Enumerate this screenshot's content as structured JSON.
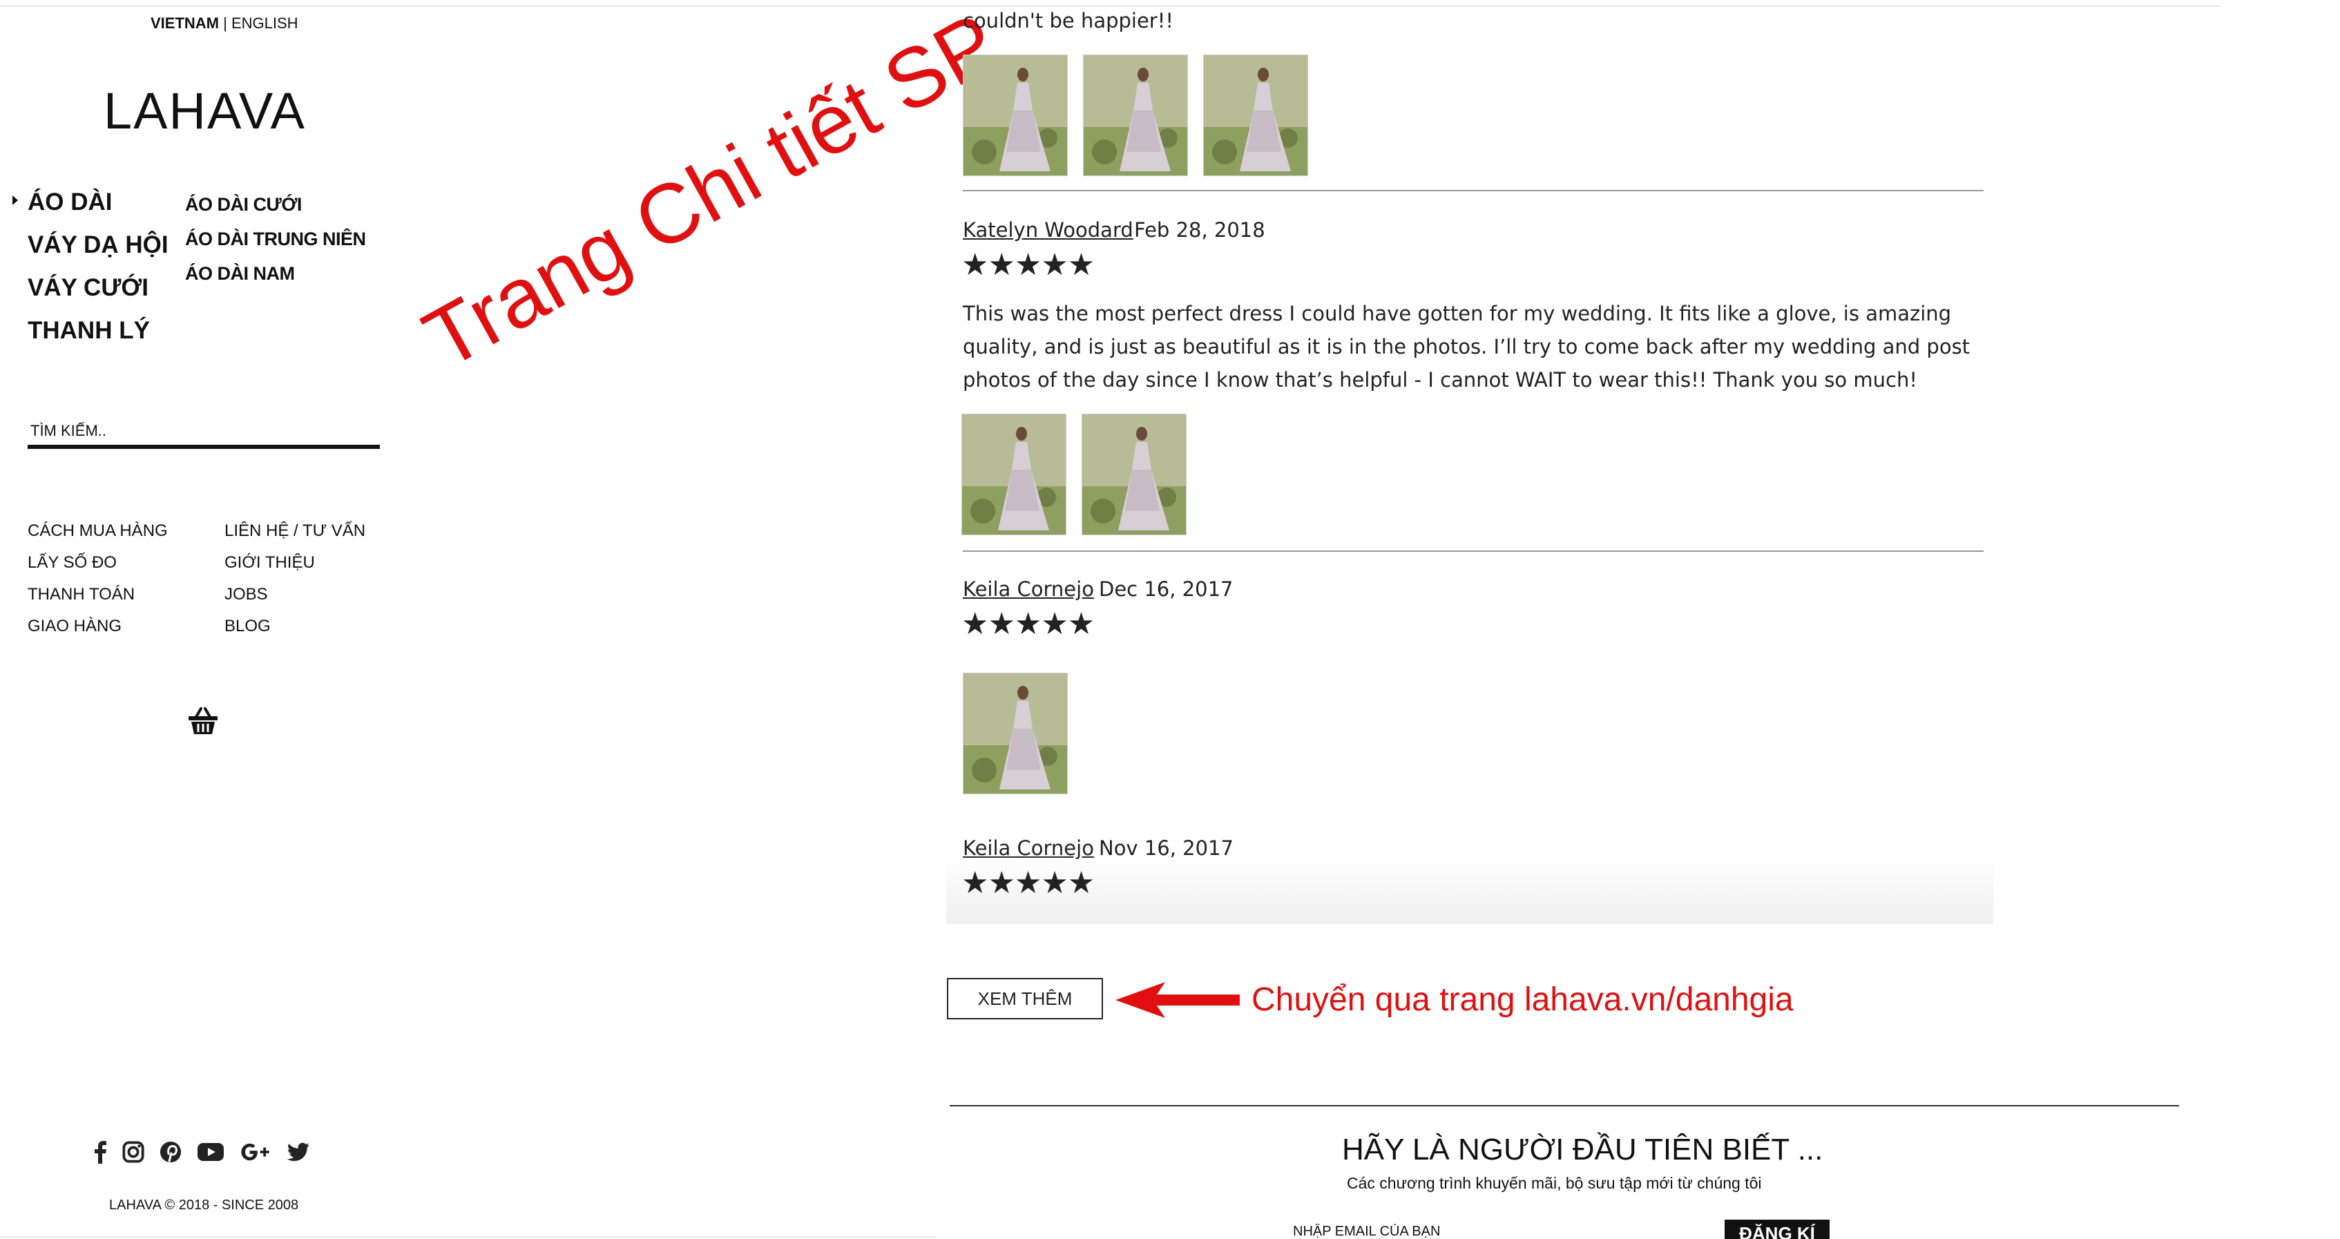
{
  "language": {
    "active": "VIETNAM",
    "separator": "|",
    "other": "ENGLISH"
  },
  "brand": {
    "logo": "LAHAVA"
  },
  "menu": {
    "main": [
      "ÁO DÀI",
      "VÁY DẠ HỘI",
      "VÁY CƯỚI",
      "THANH LÝ"
    ],
    "sub": [
      "ÁO DÀI CƯỚI",
      "ÁO DÀI TRUNG NIÊN",
      "ÁO DÀI NAM"
    ]
  },
  "search": {
    "placeholder": "TÌM KIẾM.."
  },
  "links": {
    "col1": [
      "CÁCH MUA HÀNG",
      "LẤY SỐ ĐO",
      "THANH TOÁN",
      "GIAO HÀNG"
    ],
    "col2": [
      "LIÊN HỆ / TƯ VẤN",
      "GIỚI THIỆU",
      "JOBS",
      "BLOG"
    ]
  },
  "icons": {
    "cart": "basket-icon",
    "social": [
      "facebook-icon",
      "instagram-icon",
      "pinterest-icon",
      "youtube-icon",
      "google-plus-icon",
      "twitter-icon"
    ]
  },
  "footer": {
    "copyright": "LAHAVA © 2018 - SINCE 2008"
  },
  "annotations": {
    "page_label": "Trang Chi tiết SP",
    "arrow_note": "Chuyển qua trang lahava.vn/danhgia"
  },
  "reviews": [
    {
      "author": "",
      "date": "",
      "stars": "",
      "text": "couldn't be happier!!",
      "photos": 3
    },
    {
      "author": "Katelyn Woodard",
      "date": "Feb 28, 2018",
      "stars": "★★★★★",
      "text": "This was the most perfect dress I could have gotten for my wedding. It fits like a glove, is amazing quality, and is just as beautiful as it is in the photos. I’ll try to come back after my wedding and post photos of the day since I know that’s helpful - I cannot WAIT to wear this!! Thank you so much!",
      "photos": 2
    },
    {
      "author": "Keila Cornejo",
      "date": "Dec 16, 2017",
      "stars": "★★★★★",
      "text": "",
      "photos": 1
    },
    {
      "author": "Keila Cornejo",
      "date": "Nov 16, 2017",
      "stars": "★★★★★",
      "text": "",
      "photos": 0
    }
  ],
  "more_button": {
    "label": "XEM THÊM"
  },
  "newsletter": {
    "title": "HÃY LÀ NGƯỜI ĐẦU TIÊN BIẾT ...",
    "subtitle": "Các chương trình khuyến mãi, bộ sưu tập mới từ chúng tôi",
    "email_placeholder": "NHẬP EMAIL CỦA BẠN",
    "button": "ĐĂNG KÍ"
  },
  "colors": {
    "annotation": "#e01010",
    "text": "#1a1a1a",
    "accent": "#111111"
  }
}
